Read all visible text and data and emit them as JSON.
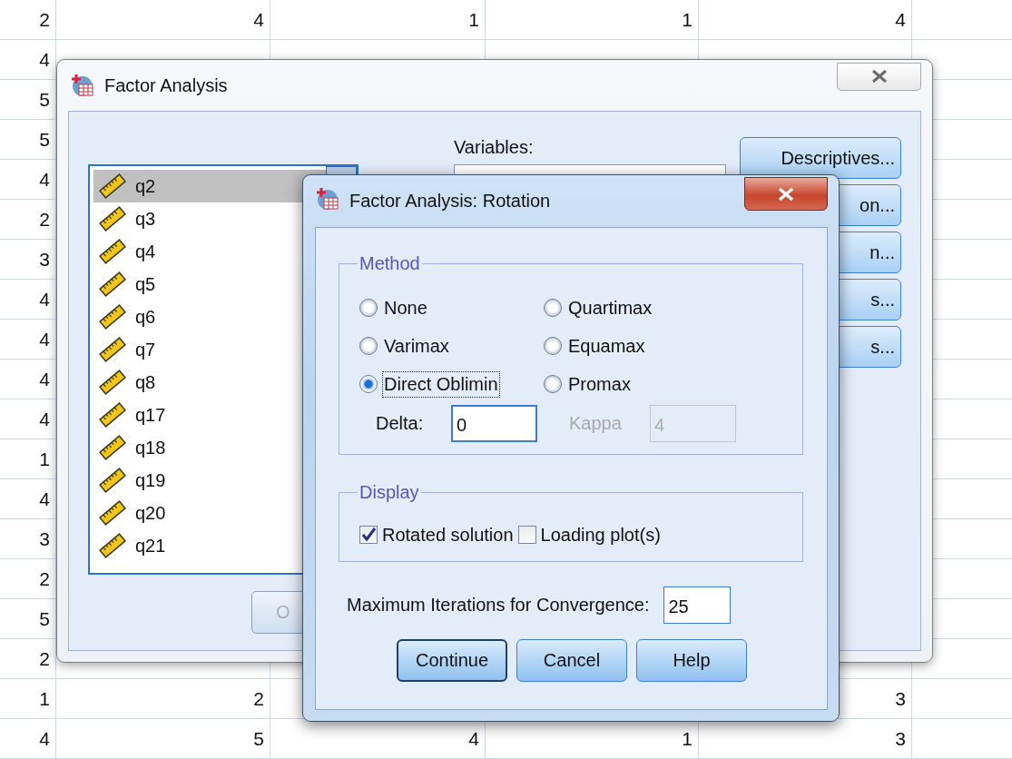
{
  "sheet": {
    "rows": [
      {
        "cells": [
          "2",
          "4",
          "1",
          "1",
          "4"
        ]
      },
      {
        "cells": [
          "4"
        ]
      },
      {
        "cells": [
          "5"
        ]
      },
      {
        "cells": [
          "5"
        ]
      },
      {
        "cells": [
          "4"
        ]
      },
      {
        "cells": [
          "2"
        ]
      },
      {
        "cells": [
          "3"
        ]
      },
      {
        "cells": [
          "4"
        ]
      },
      {
        "cells": [
          "4"
        ]
      },
      {
        "cells": [
          "4"
        ]
      },
      {
        "cells": [
          "4"
        ]
      },
      {
        "cells": [
          "1"
        ]
      },
      {
        "cells": [
          "4"
        ]
      },
      {
        "cells": [
          "3"
        ]
      },
      {
        "cells": [
          "2"
        ]
      },
      {
        "cells": [
          "5"
        ]
      },
      {
        "cells": [
          "2"
        ]
      },
      {
        "cells": [
          "1",
          "2",
          null,
          null,
          "3"
        ]
      },
      {
        "cells": [
          "4",
          "5",
          "4",
          "1",
          "3"
        ]
      }
    ]
  },
  "main_dialog": {
    "title": "Factor Analysis",
    "variable_list": [
      {
        "label": "q2",
        "selected": true
      },
      {
        "label": "q3",
        "selected": false
      },
      {
        "label": "q4",
        "selected": false
      },
      {
        "label": "q5",
        "selected": false
      },
      {
        "label": "q6",
        "selected": false
      },
      {
        "label": "q7",
        "selected": false
      },
      {
        "label": "q8",
        "selected": false
      },
      {
        "label": "q17",
        "selected": false
      },
      {
        "label": "q18",
        "selected": false
      },
      {
        "label": "q19",
        "selected": false
      },
      {
        "label": "q20",
        "selected": false
      },
      {
        "label": "q21",
        "selected": false
      }
    ],
    "variables_label": "Variables:",
    "side_buttons": [
      "Descriptives...",
      "on...",
      "n...",
      "s...",
      "s..."
    ],
    "ok_button": "O"
  },
  "rotation_dialog": {
    "title": "Factor Analysis: Rotation",
    "method": {
      "legend": "Method",
      "options": [
        {
          "label": "None",
          "selected": false
        },
        {
          "label": "Quartimax",
          "selected": false
        },
        {
          "label": "Varimax",
          "selected": false
        },
        {
          "label": "Equamax",
          "selected": false
        },
        {
          "label": "Direct Oblimin",
          "selected": true
        },
        {
          "label": "Promax",
          "selected": false
        }
      ],
      "delta": {
        "label": "Delta:",
        "value": "0",
        "disabled": false
      },
      "kappa": {
        "label": "Kappa",
        "value": "4",
        "disabled": true
      }
    },
    "display": {
      "legend": "Display",
      "options": [
        {
          "label": "Rotated solution",
          "checked": true
        },
        {
          "label": "Loading plot(s)",
          "checked": false
        }
      ]
    },
    "max_iterations": {
      "label": "Maximum Iterations for Convergence:",
      "value": "25"
    },
    "buttons": [
      {
        "label": "Continue",
        "default": true
      },
      {
        "label": "Cancel",
        "default": false
      },
      {
        "label": "Help",
        "default": false
      }
    ]
  }
}
